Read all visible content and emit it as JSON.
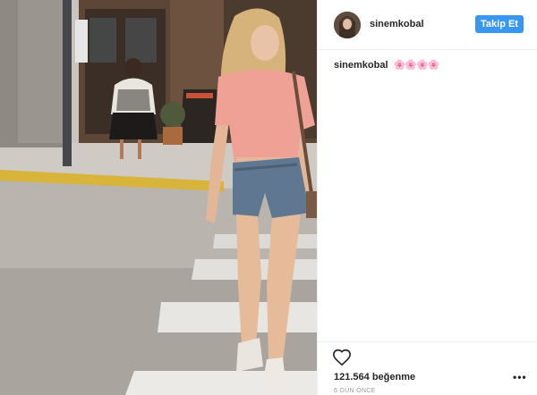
{
  "header": {
    "username": "sinemkobal",
    "follow_label": "Takip Et"
  },
  "caption": {
    "username": "sinemkobal",
    "text": "🌸🌸🌸🌸"
  },
  "actions": {
    "like_icon": "heart-icon",
    "likes": "121.564 beğenme",
    "time": "6 GÜN ÖNCE",
    "more_icon": "more-options-icon",
    "more_glyph": "•••"
  },
  "colors": {
    "follow_button": "#3897f0",
    "text": "#262626",
    "muted": "#999999"
  }
}
